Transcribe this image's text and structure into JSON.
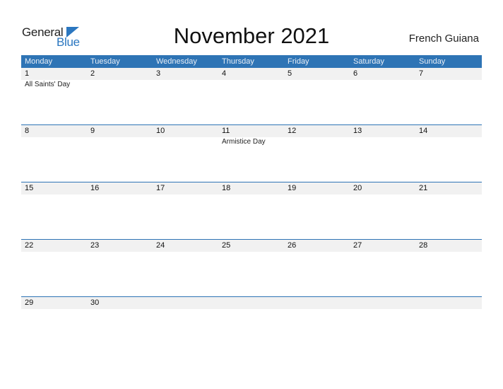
{
  "logo": {
    "word1": "General",
    "word2": "Blue",
    "accent": "#2b77c0"
  },
  "title": "November 2021",
  "region": "French Guiana",
  "colors": {
    "header_bg": "#2e74b5",
    "date_strip_bg": "#f1f1f1"
  },
  "weekdays": [
    "Monday",
    "Tuesday",
    "Wednesday",
    "Thursday",
    "Friday",
    "Saturday",
    "Sunday"
  ],
  "weeks": [
    {
      "days": [
        "1",
        "2",
        "3",
        "4",
        "5",
        "6",
        "7"
      ],
      "events": [
        "All Saints' Day",
        "",
        "",
        "",
        "",
        "",
        ""
      ]
    },
    {
      "days": [
        "8",
        "9",
        "10",
        "11",
        "12",
        "13",
        "14"
      ],
      "events": [
        "",
        "",
        "",
        "Armistice Day",
        "",
        "",
        ""
      ]
    },
    {
      "days": [
        "15",
        "16",
        "17",
        "18",
        "19",
        "20",
        "21"
      ],
      "events": [
        "",
        "",
        "",
        "",
        "",
        "",
        ""
      ]
    },
    {
      "days": [
        "22",
        "23",
        "24",
        "25",
        "26",
        "27",
        "28"
      ],
      "events": [
        "",
        "",
        "",
        "",
        "",
        "",
        ""
      ]
    },
    {
      "days": [
        "29",
        "30",
        "",
        "",
        "",
        "",
        ""
      ],
      "events": [
        "",
        "",
        "",
        "",
        "",
        "",
        ""
      ]
    }
  ]
}
